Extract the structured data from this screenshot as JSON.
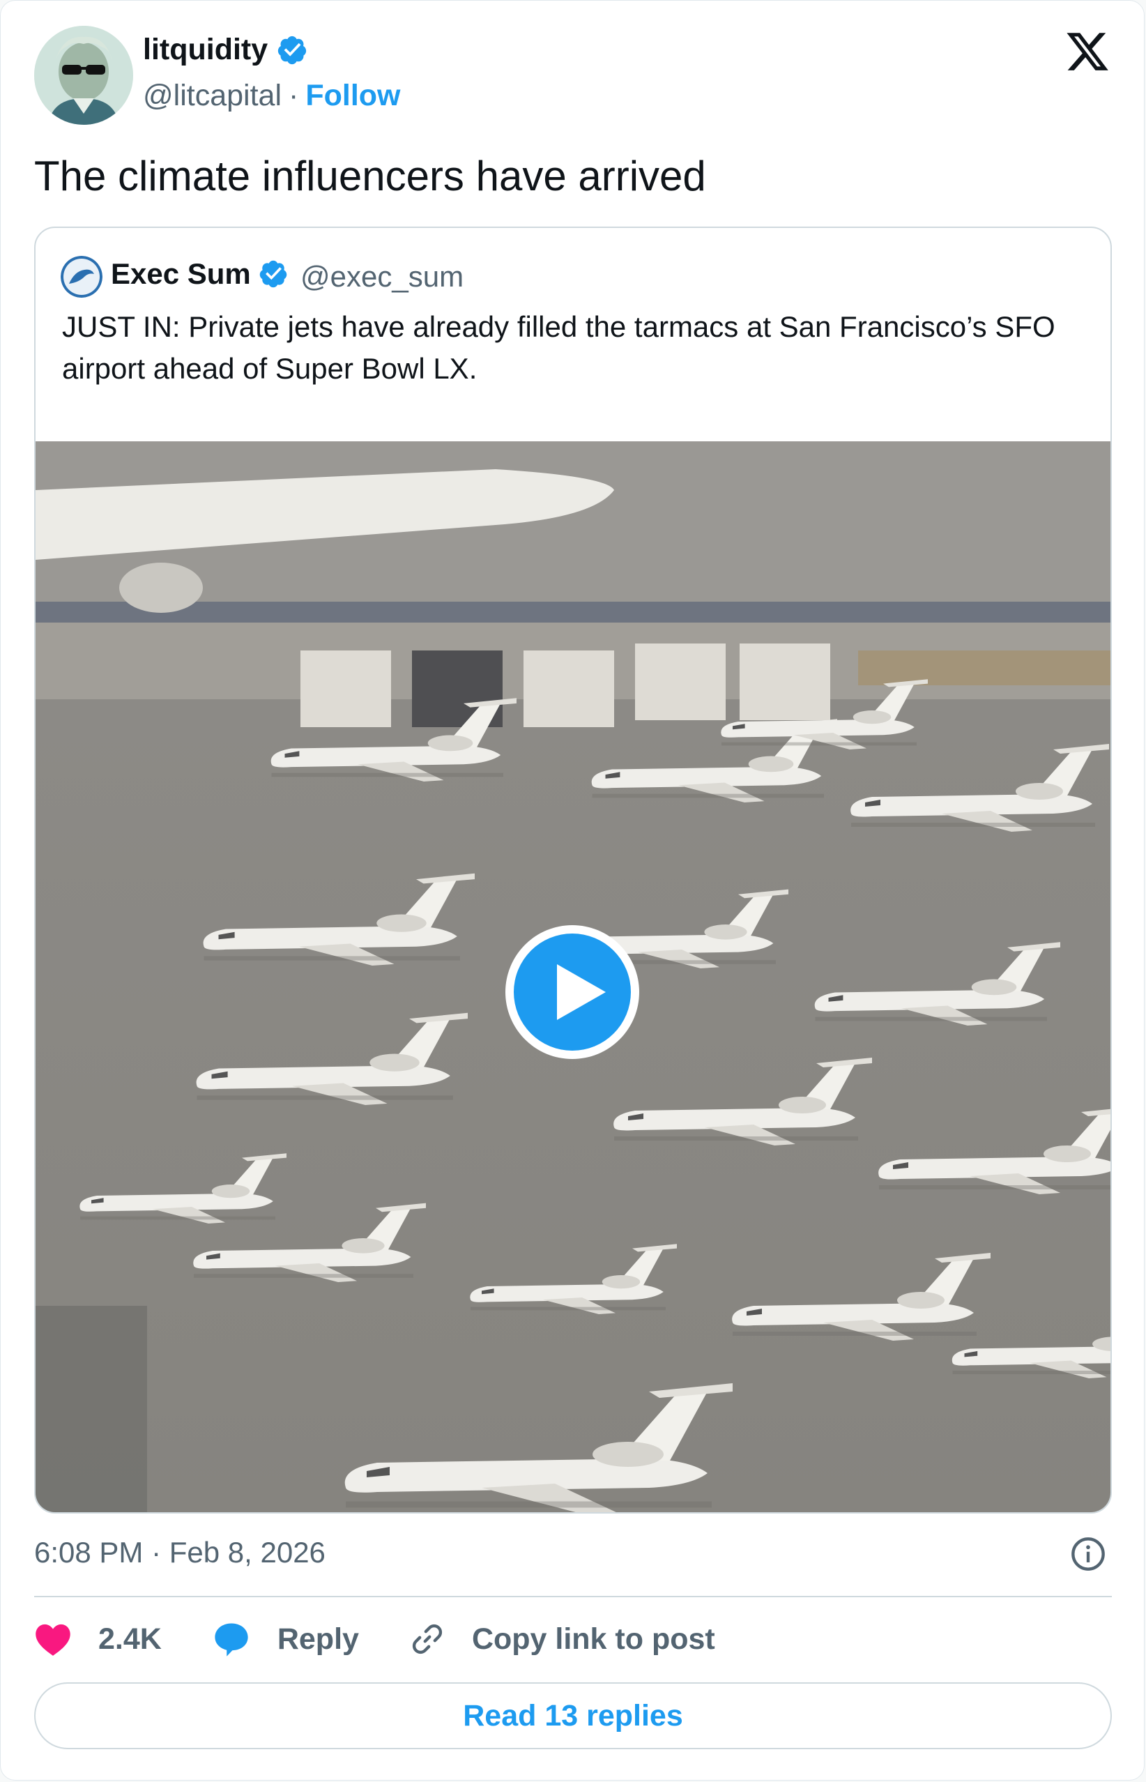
{
  "author": {
    "name": "litquidity",
    "handle": "@litcapital",
    "separator": "·",
    "follow_label": "Follow",
    "verified_color": "#1d9bf0"
  },
  "tweet": {
    "text": "The climate influencers have arrived",
    "timestamp": "6:08 PM · Feb 8, 2026"
  },
  "quoted": {
    "name": "Exec Sum",
    "handle": "@exec_sum",
    "text": "JUST IN: Private jets have already filled the tarmacs at San Francisco’s SFO airport ahead of Super Bowl LX.",
    "media": {
      "type": "video",
      "icon": "play-icon"
    }
  },
  "actions": {
    "likes": "2.4K",
    "reply_label": "Reply",
    "copy_label": "Copy link to post"
  },
  "footer": {
    "read_replies_label": "Read 13 replies"
  },
  "colors": {
    "accent": "#1d9bf0",
    "like": "#f91880",
    "muted": "#536471"
  }
}
